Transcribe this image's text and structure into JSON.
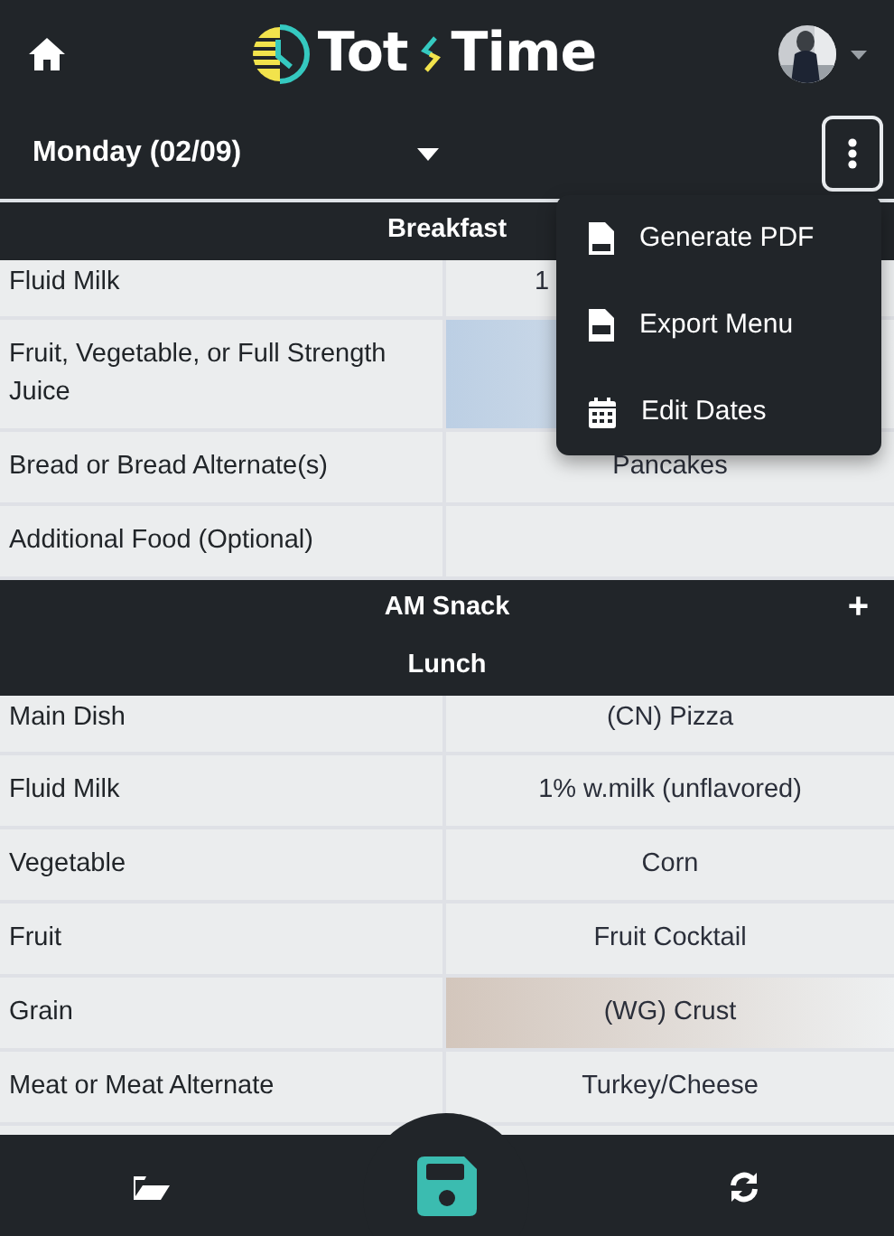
{
  "header": {
    "logo_left": "Tot",
    "logo_right": "Time"
  },
  "day_selector": {
    "value": "Monday (02/09)"
  },
  "actions_menu": {
    "expanded": true,
    "items": [
      {
        "kind": "pdf",
        "label": "Generate PDF"
      },
      {
        "kind": "csv",
        "label": "Export Menu"
      },
      {
        "kind": "calendar",
        "label": "Edit Dates"
      }
    ]
  },
  "meals": [
    {
      "title": "Breakfast",
      "add_button": false,
      "rows": [
        {
          "component": "Fluid Milk",
          "value": "1",
          "covered": true
        },
        {
          "component": "Fruit, Vegetable, or Full Strength Juice",
          "color": "#bccfe4"
        },
        {
          "component": "Bread or Bread Alternate(s)",
          "value": "Pancakes"
        },
        {
          "component": "Additional Food (Optional)"
        }
      ]
    },
    {
      "title": "AM Snack",
      "add_button": true,
      "add_label": "+"
    },
    {
      "title": "Lunch",
      "add_button": false,
      "rows": [
        {
          "component": "Main Dish",
          "value": "(CN) Pizza"
        },
        {
          "component": "Fluid Milk",
          "value": "1% w.milk (unflavored)"
        },
        {
          "component": "Vegetable",
          "value": "Corn"
        },
        {
          "component": "Fruit",
          "value": "Fruit Cocktail"
        },
        {
          "component": "Grain",
          "value": "(WG) Crust",
          "color": "#d3c6bc"
        },
        {
          "component": "Meat or Meat Alternate",
          "value": "Turkey/Cheese"
        }
      ]
    }
  ]
}
